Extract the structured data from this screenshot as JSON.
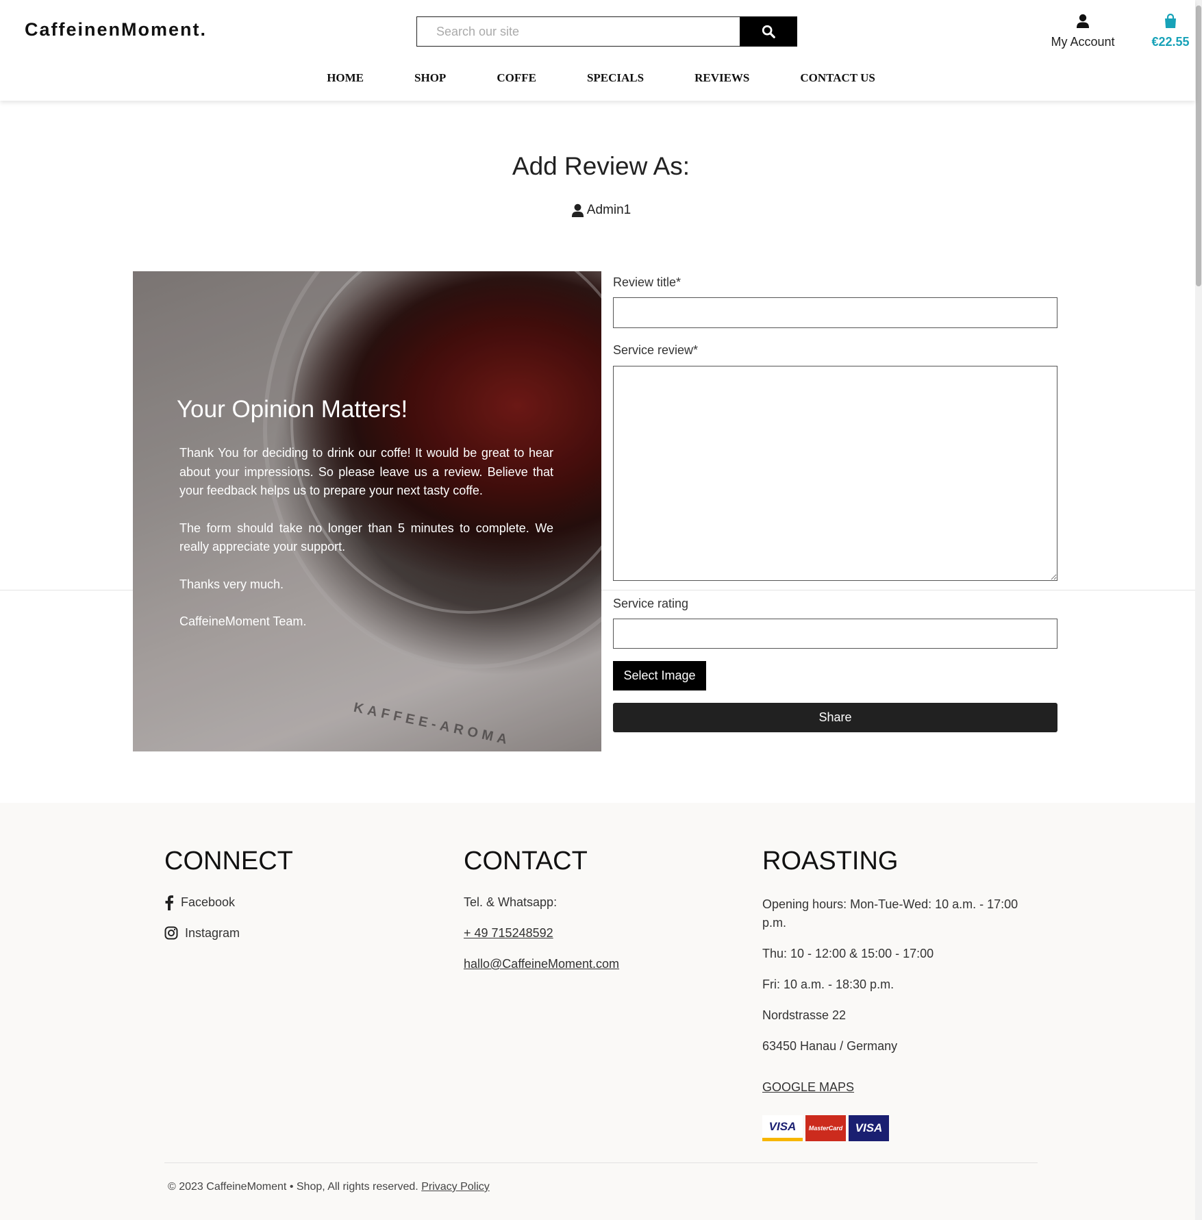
{
  "header": {
    "logo": "CaffeinenMoment.",
    "search_placeholder": "Search our site",
    "account_label": "My Account",
    "cart_total": "€22.55",
    "nav": [
      "HOME",
      "SHOP",
      "COFFE",
      "SPECIALS",
      "REVIEWS",
      "CONTACT US"
    ]
  },
  "main": {
    "title": "Add Review As:",
    "username": "Admin1"
  },
  "panel": {
    "heading": "Your Opinion Matters!",
    "paragraphs": [
      "Thank You for deciding to drink our coffe! It would be great to hear about your impressions. So please leave us a review. Believe that your feedback helps us to prepare your next tasty coffe.",
      "The form should take no longer than 5 minutes to complete. We really appreciate your support.",
      "Thanks very much.",
      "CaffeineMoment Team."
    ],
    "image_text": "KAFFEE-AROMA"
  },
  "form": {
    "title_label": "Review title*",
    "title_value": "",
    "review_label": "Service review*",
    "review_value": "",
    "rating_label": "Service rating",
    "rating_value": "",
    "select_image_label": "Select Image",
    "share_label": "Share"
  },
  "footer": {
    "connect": {
      "heading": "CONNECT",
      "links": [
        "Facebook",
        "Instagram"
      ]
    },
    "contact": {
      "heading": "CONTACT",
      "tel_label": "Tel. & Whatsapp:",
      "phone": "+ 49 715248592",
      "email": "hallo@CaffeineMoment.com"
    },
    "roasting": {
      "heading": "ROASTING",
      "lines": [
        "Opening hours: Mon-Tue-Wed: 10 a.m. - 17:00 p.m.",
        "Thu: 10 - 12:00 & 15:00 - 17:00",
        "Fri: 10 a.m. - 18:30 p.m.",
        "Nordstrasse 22",
        "63450 Hanau / Germany"
      ],
      "maps_link": "GOOGLE MAPS",
      "payment_cards": [
        "VISA",
        "MasterCard",
        "VISA"
      ]
    },
    "copyright": "© 2023 CaffeineMoment • Shop, All rights reserved.",
    "privacy_link": "Privacy Policy"
  },
  "colors": {
    "accent": "#17a2b8",
    "footer_bg": "#faf9f7",
    "button_dark": "#212121"
  },
  "icons": [
    "search-icon",
    "user-icon",
    "shopping-bag-icon",
    "facebook-icon",
    "instagram-icon"
  ]
}
